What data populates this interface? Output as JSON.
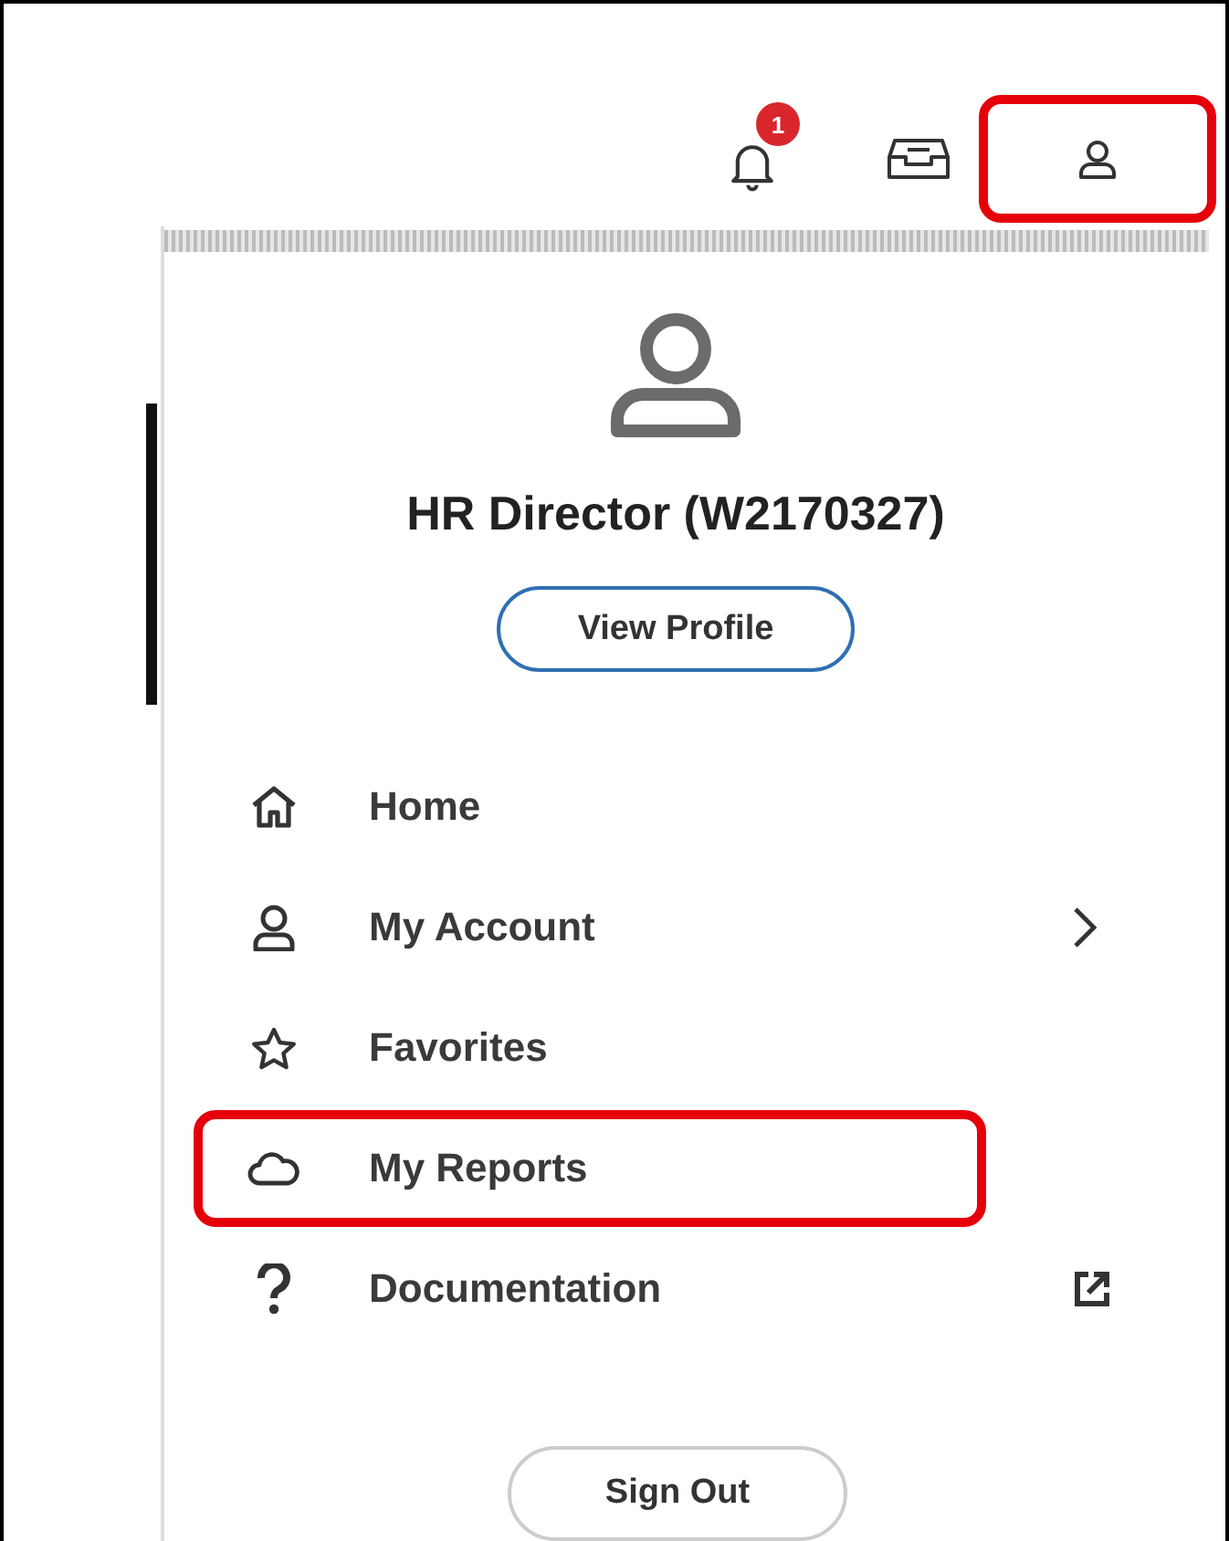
{
  "top_bar": {
    "notifications": {
      "badge": "1"
    },
    "profile_button": {
      "highlighted": true
    }
  },
  "profile_menu": {
    "name": "HR Director (W2170327)",
    "view_profile_button": "View Profile",
    "items": [
      {
        "label": "Home",
        "kind": "link",
        "highlighted": false
      },
      {
        "label": "My Account",
        "kind": "submenu",
        "highlighted": false
      },
      {
        "label": "Favorites",
        "kind": "link",
        "highlighted": false
      },
      {
        "label": "My Reports",
        "kind": "link",
        "highlighted": true
      },
      {
        "label": "Documentation",
        "kind": "external",
        "highlighted": false
      }
    ],
    "sign_out_button": "Sign Out"
  }
}
